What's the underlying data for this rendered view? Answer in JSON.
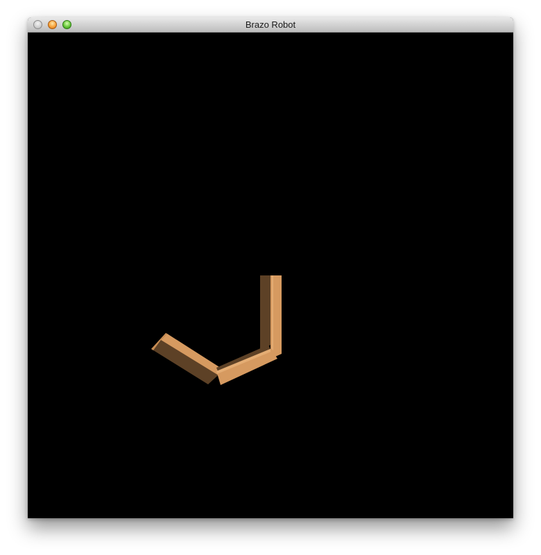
{
  "window": {
    "title": "Brazo Robot"
  },
  "title_bar_buttons": [
    "close",
    "minimize",
    "zoom"
  ],
  "scene": {
    "background_color": "#000000",
    "arm_colors": {
      "lit": "#d69a60",
      "highlight": "#e4ad74",
      "shadow": "#5d4126",
      "dark": "#3e2a18"
    }
  }
}
